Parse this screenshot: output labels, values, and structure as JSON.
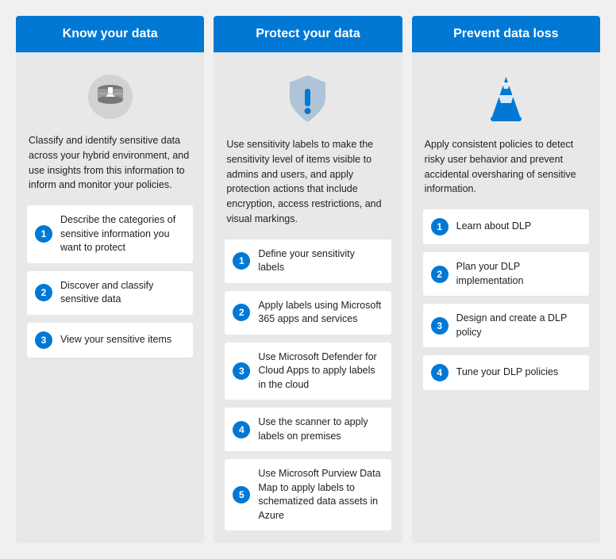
{
  "cards": [
    {
      "id": "know-your-data",
      "header": "Know your data",
      "icon": "classify-icon",
      "description": "Classify and identify sensitive data across your hybrid environment, and use insights from this information to inform and monitor your policies.",
      "steps": [
        {
          "number": 1,
          "label": "Describe the categories of sensitive information you want to protect"
        },
        {
          "number": 2,
          "label": "Discover and classify sensitive data"
        },
        {
          "number": 3,
          "label": "View your sensitive items"
        }
      ]
    },
    {
      "id": "protect-your-data",
      "header": "Protect your data",
      "icon": "shield-icon",
      "description": "Use sensitivity labels to make the sensitivity level of items visible to admins and users, and apply protection actions that include encryption, access restrictions, and visual markings.",
      "steps": [
        {
          "number": 1,
          "label": "Define your sensitivity labels"
        },
        {
          "number": 2,
          "label": "Apply labels using Microsoft 365 apps and services"
        },
        {
          "number": 3,
          "label": "Use Microsoft Defender for Cloud Apps to apply labels in the cloud"
        },
        {
          "number": 4,
          "label": "Use the scanner to apply labels on premises"
        },
        {
          "number": 5,
          "label": "Use Microsoft Purview Data Map to apply labels to schematized data assets in Azure"
        }
      ]
    },
    {
      "id": "prevent-data-loss",
      "header": "Prevent data loss",
      "icon": "cone-icon",
      "description": "Apply consistent policies to detect risky user behavior and prevent accidental oversharing of sensitive information.",
      "steps": [
        {
          "number": 1,
          "label": "Learn about DLP"
        },
        {
          "number": 2,
          "label": "Plan your DLP implementation"
        },
        {
          "number": 3,
          "label": "Design and create a DLP policy"
        },
        {
          "number": 4,
          "label": "Tune your DLP policies"
        }
      ]
    }
  ]
}
